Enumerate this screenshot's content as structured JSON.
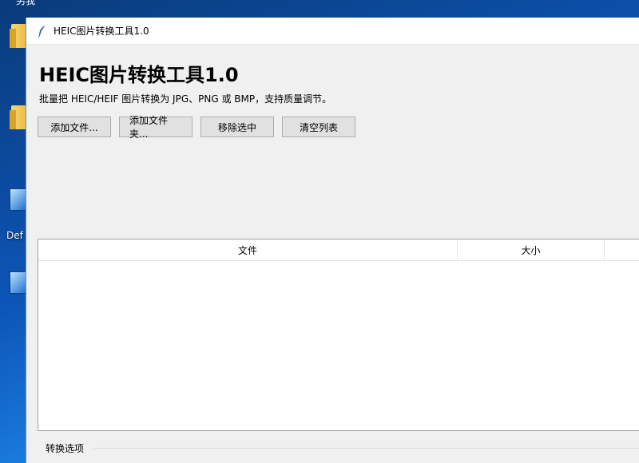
{
  "desktop": {
    "top_label": "另我",
    "icon_labels": [
      "Def"
    ]
  },
  "window": {
    "title": "HEIC图片转换工具1.0",
    "heading": "HEIC图片转换工具1.0",
    "subtitle": "批量把 HEIC/HEIF 图片转换为 JPG、PNG 或 BMP，支持质量调节。",
    "buttons": {
      "add_files": "添加文件...",
      "add_folder": "添加文件夹...",
      "remove_selected": "移除选中",
      "clear_list": "清空列表"
    },
    "table": {
      "columns": [
        "文件",
        "大小"
      ]
    },
    "options_label": "转换选项"
  },
  "icons": [
    "feather-icon",
    "folder-icon",
    "monitor-icon"
  ]
}
